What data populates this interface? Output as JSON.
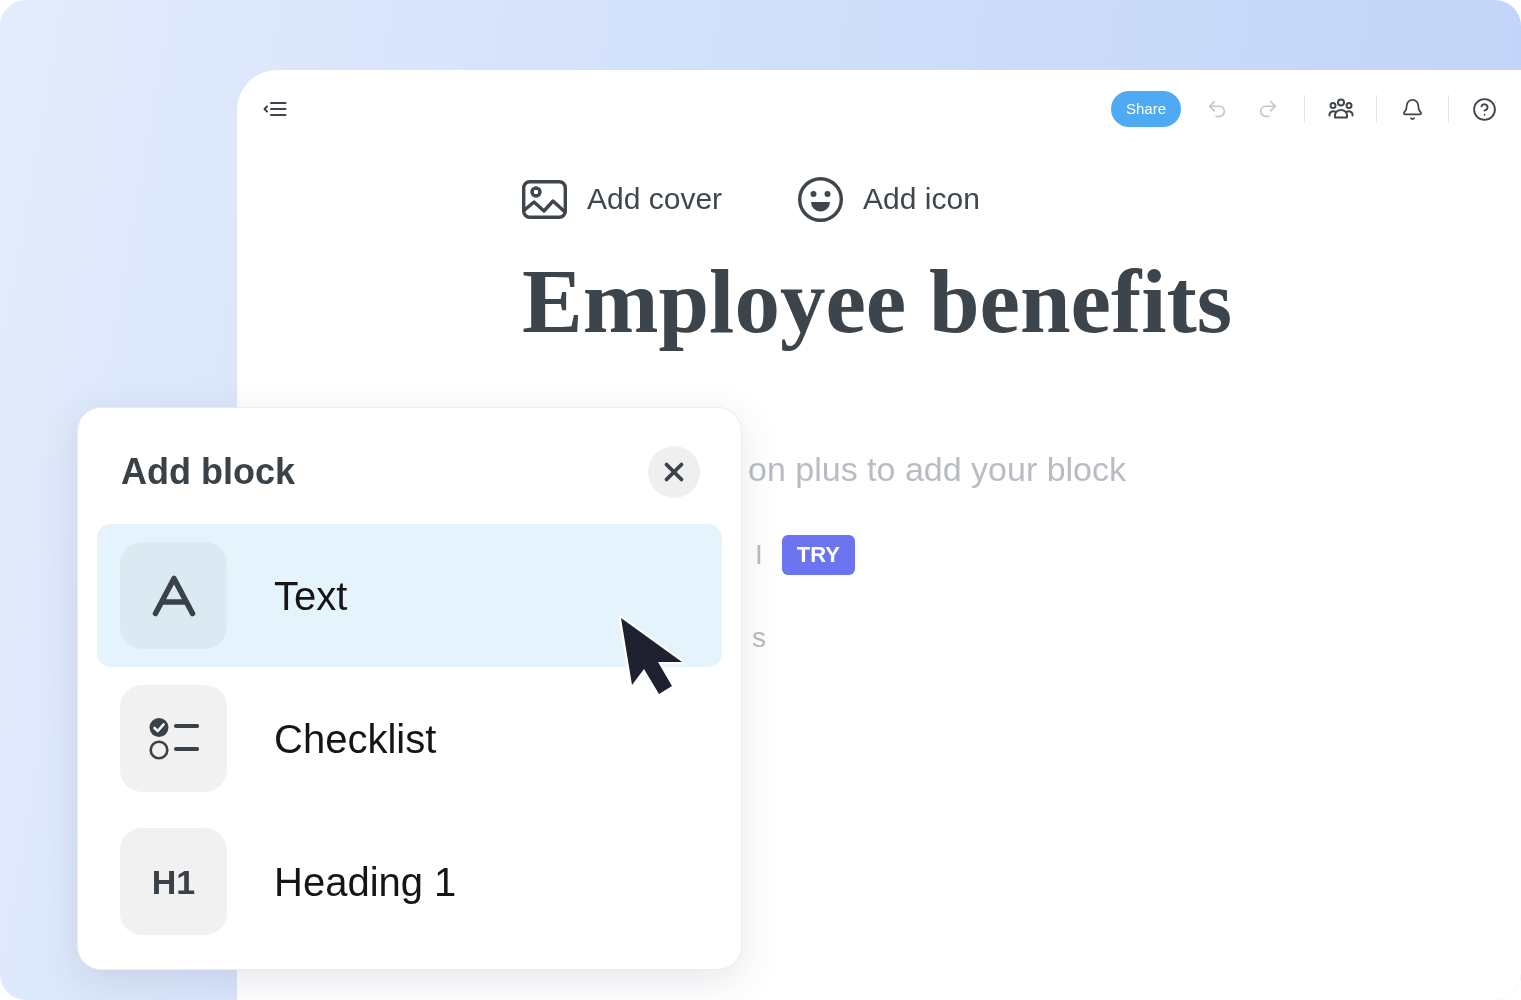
{
  "header": {
    "share_label": "Share",
    "history": [
      {
        "kind": "undo",
        "disabled": true
      },
      {
        "kind": "redo",
        "disabled": true
      }
    ]
  },
  "page": {
    "actions": [
      {
        "kind": "cover",
        "label": "Add cover"
      },
      {
        "kind": "icon",
        "label": "Add icon"
      }
    ],
    "title": "Employee benefits",
    "block_hint": "on plus to add your block",
    "ai_option": {
      "label": "I",
      "badge": "TRY"
    },
    "option_fragment": "s"
  },
  "add_block_panel": {
    "title": "Add block",
    "items": [
      {
        "kind": "text",
        "label": "Text",
        "selected": true
      },
      {
        "kind": "checklist",
        "label": "Checklist",
        "selected": false
      },
      {
        "kind": "heading",
        "tile_text": "H1",
        "label": "Heading 1",
        "selected": false
      }
    ]
  }
}
